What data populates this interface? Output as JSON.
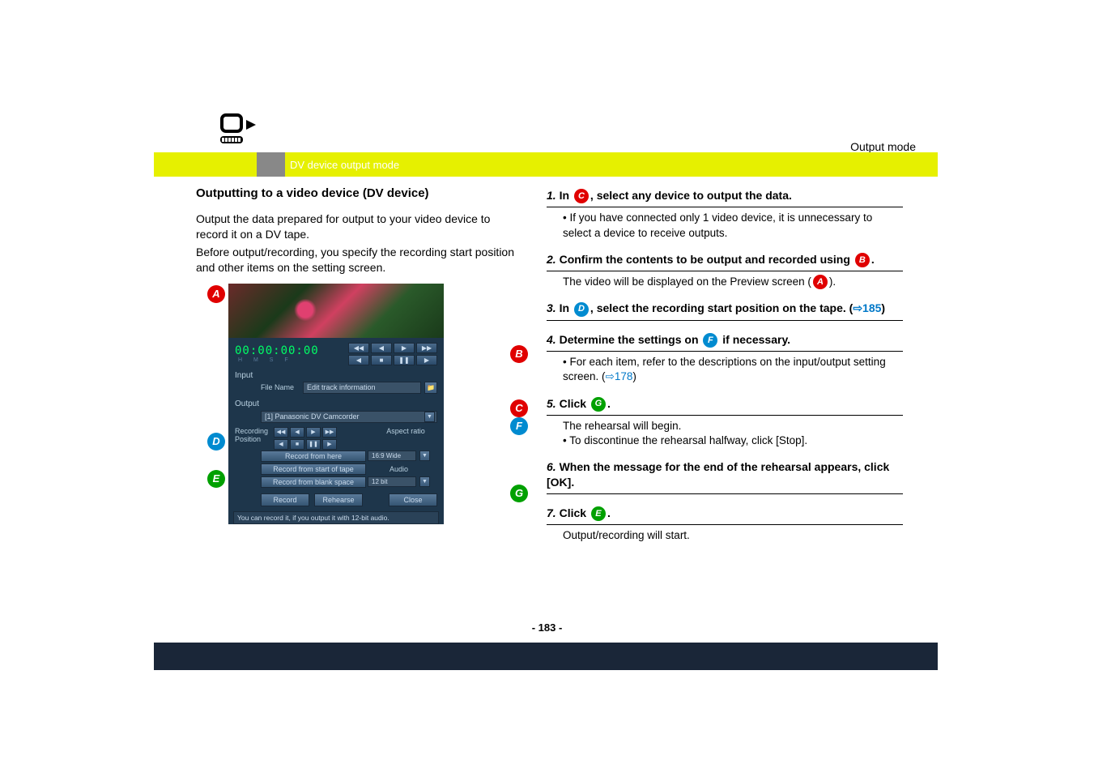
{
  "header": {
    "output_mode_label": "Output mode",
    "breadcrumb": "DV device output mode"
  },
  "left": {
    "title": "Outputting to a video device (DV device)",
    "para1": "Output the data prepared for output to your video device to record it on a DV tape.",
    "para2": "Before output/recording, you specify the recording start position and other items on the setting screen."
  },
  "screenshot": {
    "timecode": "00:00:00:00",
    "input_label": "Input",
    "filename_label": "File Name",
    "filename_value": "Edit track information",
    "output_label": "Output",
    "device_value": "[1] Panasonic DV Camcorder",
    "recpos_label": "Recording Position",
    "btn_record_here": "Record from here",
    "btn_record_start": "Record from start of tape",
    "btn_record_blank": "Record from blank space",
    "aspect_label": "Aspect ratio",
    "aspect_value": "16:9 Wide",
    "audio_label": "Audio",
    "audio_value": "12 bit",
    "btn_record": "Record",
    "btn_rehearse": "Rehearse",
    "btn_close": "Close",
    "status_text": "You can record it, if you output it with 12-bit audio."
  },
  "labels": {
    "A": "A",
    "B": "B",
    "C": "C",
    "D": "D",
    "E": "E",
    "F": "F",
    "G": "G"
  },
  "steps": {
    "s1": {
      "num": "1.",
      "pre": "In ",
      "post": ", select any device to output the data.",
      "body": "• If you have connected only 1 video device, it is unnecessary to select a device to receive outputs."
    },
    "s2": {
      "num": "2.",
      "text_a": "Confirm the contents to be output and recorded using ",
      "text_b": ".",
      "body_a": "The video will be displayed on the Preview screen (",
      "body_b": ")."
    },
    "s3": {
      "num": "3.",
      "pre": "In ",
      "mid": ", select the recording start position on the tape. (",
      "ref": "185",
      "post": ")"
    },
    "s4": {
      "num": "4.",
      "pre": "Determine the settings on ",
      "post": " if necessary.",
      "body_a": "• For each item, refer to the descriptions on the input/output setting screen. (",
      "ref": "178",
      "body_b": ")"
    },
    "s5": {
      "num": "5.",
      "pre": "Click ",
      "post": ".",
      "body1": "The rehearsal will begin.",
      "body2": "• To discontinue the rehearsal halfway, click [Stop]."
    },
    "s6": {
      "num": "6.",
      "text": "When the message for the end of the rehearsal appears, click [OK]."
    },
    "s7": {
      "num": "7.",
      "pre": "Click ",
      "post": ".",
      "body": "Output/recording will start."
    }
  },
  "page_num": "- 183 -"
}
